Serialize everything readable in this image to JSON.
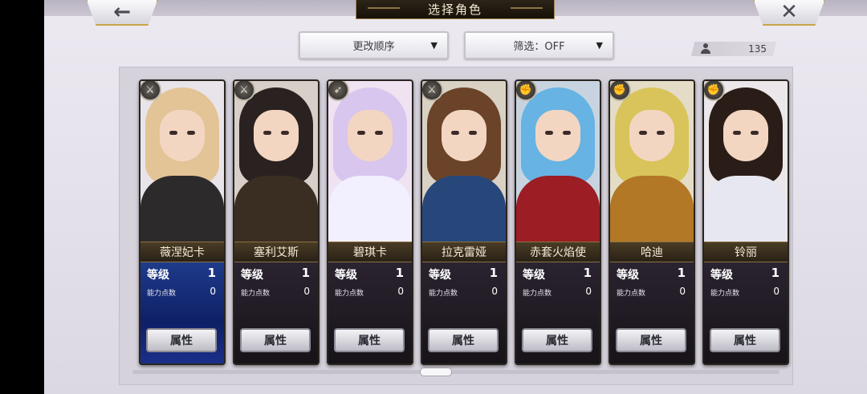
{
  "header": {
    "title": "选择角色",
    "back_icon": "←",
    "close_icon": "✕"
  },
  "controls": {
    "sort_label": "更改顺序",
    "filter_label": "筛选：OFF",
    "dropdown_arrow": "▼",
    "character_count": "135"
  },
  "labels": {
    "level": "等级",
    "ability_points": "能力点数",
    "attribute_button": "属性"
  },
  "colors": {
    "accent_gold": "#c9a44a",
    "selected_stat_bg": "#1e3b8a"
  },
  "characters": [
    {
      "name": "薇涅妃卡",
      "level": "1",
      "ability_points": "0",
      "type_icon": "⚔",
      "selected": true
    },
    {
      "name": "塞利艾斯",
      "level": "1",
      "ability_points": "0",
      "type_icon": "⚔",
      "selected": false
    },
    {
      "name": "碧琪卡",
      "level": "1",
      "ability_points": "0",
      "type_icon": "➶",
      "selected": false
    },
    {
      "name": "拉克雷娅",
      "level": "1",
      "ability_points": "0",
      "type_icon": "⚔",
      "selected": false
    },
    {
      "name": "赤套火焰使",
      "level": "1",
      "ability_points": "0",
      "type_icon": "✊",
      "selected": false
    },
    {
      "name": "哈迪",
      "level": "1",
      "ability_points": "0",
      "type_icon": "✊",
      "selected": false
    },
    {
      "name": "铃丽",
      "level": "1",
      "ability_points": "0",
      "type_icon": "✊",
      "selected": false
    }
  ]
}
